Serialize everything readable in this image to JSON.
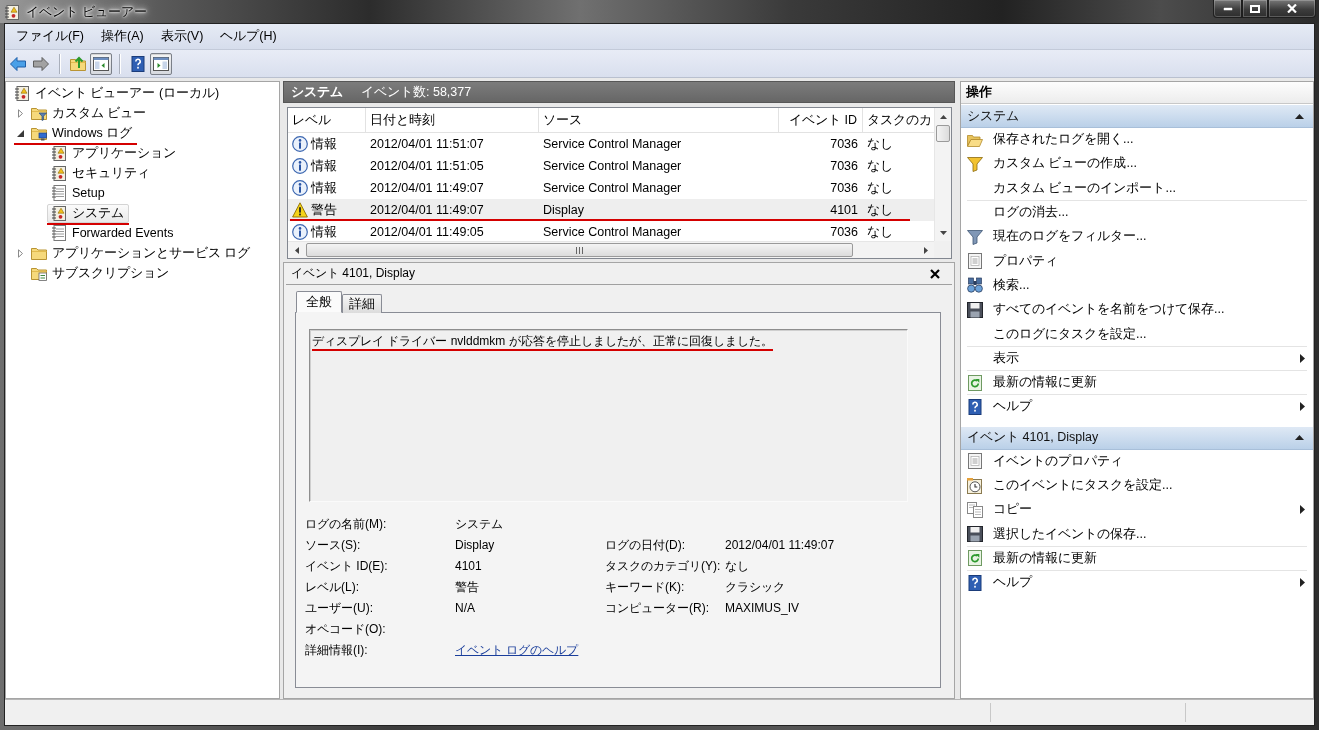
{
  "window": {
    "title": "イベント ビューアー"
  },
  "menu": [
    {
      "label": "ファイル(F)"
    },
    {
      "label": "操作(A)"
    },
    {
      "label": "表示(V)"
    },
    {
      "label": "ヘルプ(H)"
    }
  ],
  "toolbar": [
    [
      {
        "kind": "back",
        "disabled": false,
        "pressed": false
      },
      {
        "kind": "forward",
        "disabled": true,
        "pressed": false
      }
    ],
    [
      {
        "kind": "up",
        "disabled": false,
        "pressed": false
      },
      {
        "kind": "tree",
        "disabled": false,
        "pressed": true
      }
    ],
    [
      {
        "kind": "help",
        "disabled": false,
        "pressed": false
      },
      {
        "kind": "actions",
        "disabled": false,
        "pressed": true
      }
    ]
  ],
  "tree": [
    {
      "kind": "viewer",
      "label": "イベント ビューアー (ローカル)",
      "selected": false,
      "marked": false,
      "children": [
        {
          "kind": "viewfolder",
          "label": "カスタム ビュー",
          "expanded": false,
          "selected": false,
          "marked": false
        },
        {
          "kind": "logfolder",
          "label": "Windows ログ",
          "expanded": true,
          "selected": false,
          "marked": true,
          "children": [
            {
              "kind": "eventlog",
              "label": "アプリケーション",
              "selected": false,
              "marked": false
            },
            {
              "kind": "eventlog",
              "label": "セキュリティ",
              "selected": false,
              "marked": false
            },
            {
              "kind": "log",
              "label": "Setup",
              "selected": false,
              "marked": false
            },
            {
              "kind": "eventlog",
              "label": "システム",
              "selected": true,
              "marked": true
            },
            {
              "kind": "log",
              "label": "Forwarded Events",
              "selected": false,
              "marked": false
            }
          ]
        },
        {
          "kind": "folder",
          "label": "アプリケーションとサービス ログ",
          "expanded": false,
          "selected": false,
          "marked": false
        },
        {
          "kind": "subfolder",
          "label": "サブスクリプション",
          "selected": false,
          "marked": false
        }
      ]
    }
  ],
  "log_header": {
    "name": "システム",
    "count": "イベント数: 58,377"
  },
  "events": {
    "columns": [
      {
        "kind": "text",
        "label": "レベル"
      },
      {
        "kind": "text",
        "label": "日付と時刻"
      },
      {
        "kind": "text",
        "label": "ソース"
      },
      {
        "kind": "number",
        "label": "イベント ID"
      },
      {
        "kind": "text",
        "label": "タスクのカ"
      }
    ],
    "rows": [
      {
        "kind": "info",
        "cells": [
          "情報",
          "2012/04/01 11:51:07",
          "Service Control Manager",
          "7036",
          "なし"
        ],
        "selected": false,
        "marked": false
      },
      {
        "kind": "info",
        "cells": [
          "情報",
          "2012/04/01 11:51:05",
          "Service Control Manager",
          "7036",
          "なし"
        ],
        "selected": false,
        "marked": false
      },
      {
        "kind": "info",
        "cells": [
          "情報",
          "2012/04/01 11:49:07",
          "Service Control Manager",
          "7036",
          "なし"
        ],
        "selected": false,
        "marked": false
      },
      {
        "kind": "warning",
        "cells": [
          "警告",
          "2012/04/01 11:49:07",
          "Display",
          "4101",
          "なし"
        ],
        "selected": true,
        "marked": true
      },
      {
        "kind": "info",
        "cells": [
          "情報",
          "2012/04/01 11:49:05",
          "Service Control Manager",
          "7036",
          "なし"
        ],
        "selected": false,
        "marked": false
      }
    ]
  },
  "detail": {
    "title": "イベント 4101, Display",
    "tabs": [
      {
        "label": "全般",
        "selected": true
      },
      {
        "label": "詳細",
        "selected": false
      }
    ],
    "message": {
      "text": "ディスプレイ ドライバー nvlddmkm が応答を停止しましたが、正常に回復しました。",
      "marked": true
    },
    "fields": [
      {
        "left": {
          "label": "ログの名前(M):",
          "value": "システム"
        }
      },
      {
        "left": {
          "label": "ソース(S):",
          "value": "Display"
        },
        "right": {
          "label": "ログの日付(D):",
          "value": "2012/04/01 11:49:07"
        }
      },
      {
        "left": {
          "label": "イベント ID(E):",
          "value": "4101"
        },
        "right": {
          "label": "タスクのカテゴリ(Y):",
          "value": "なし"
        }
      },
      {
        "left": {
          "label": "レベル(L):",
          "value": "警告"
        },
        "right": {
          "label": "キーワード(K):",
          "value": "クラシック"
        }
      },
      {
        "left": {
          "label": "ユーザー(U):",
          "value": "N/A"
        },
        "right": {
          "label": "コンピューター(R):",
          "value": "MAXIMUS_IV"
        }
      },
      {
        "left": {
          "label": "オペコード(O):"
        }
      },
      {
        "left": {
          "label": "詳細情報(I):",
          "link": "イベント ログのヘルプ"
        }
      }
    ]
  },
  "actions": {
    "title": "操作",
    "sections": [
      {
        "title": "システム",
        "expanded": true,
        "items": [
          {
            "kind": "open",
            "label": "保存されたログを開く...",
            "submenu": false,
            "divider": false
          },
          {
            "kind": "newview",
            "label": "カスタム ビューの作成...",
            "submenu": false,
            "divider": false
          },
          {
            "kind": "plain",
            "label": "カスタム ビューのインポート...",
            "submenu": false,
            "divider": true
          },
          {
            "kind": "plain",
            "label": "ログの消去...",
            "submenu": false,
            "divider": false
          },
          {
            "kind": "filter",
            "label": "現在のログをフィルター...",
            "submenu": false,
            "divider": false
          },
          {
            "kind": "props",
            "label": "プロパティ",
            "submenu": false,
            "divider": false
          },
          {
            "kind": "find",
            "label": "検索...",
            "submenu": false,
            "divider": false
          },
          {
            "kind": "save",
            "label": "すべてのイベントを名前をつけて保存...",
            "submenu": false,
            "divider": false
          },
          {
            "kind": "plain",
            "label": "このログにタスクを設定...",
            "submenu": false,
            "divider": true
          },
          {
            "kind": "plain",
            "label": "表示",
            "submenu": true,
            "divider": true
          },
          {
            "kind": "refresh",
            "label": "最新の情報に更新",
            "submenu": false,
            "divider": true
          },
          {
            "kind": "help",
            "label": "ヘルプ",
            "submenu": true,
            "divider": false
          }
        ]
      },
      {
        "title": "イベント 4101, Display",
        "expanded": true,
        "items": [
          {
            "kind": "props",
            "label": "イベントのプロパティ",
            "submenu": false,
            "divider": false
          },
          {
            "kind": "task",
            "label": "このイベントにタスクを設定...",
            "submenu": false,
            "divider": false
          },
          {
            "kind": "copy",
            "label": "コピー",
            "submenu": true,
            "divider": false
          },
          {
            "kind": "save",
            "label": "選択したイベントの保存...",
            "submenu": false,
            "divider": true
          },
          {
            "kind": "refresh",
            "label": "最新の情報に更新",
            "submenu": false,
            "divider": true
          },
          {
            "kind": "help",
            "label": "ヘルプ",
            "submenu": true,
            "divider": false
          }
        ]
      }
    ]
  }
}
